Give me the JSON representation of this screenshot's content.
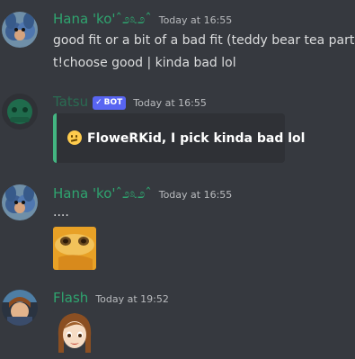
{
  "messages": [
    {
      "username": "Hana 'ko'ˆ೨೩೨ˆ",
      "timestamp": "Today at 16:55",
      "lines": [
        "good fit or a bit of a bad fit (teddy bear tea party)",
        "t!choose good | kinda bad lol"
      ]
    },
    {
      "username": "Tatsu",
      "badge": "BOT",
      "timestamp": "Today at 16:55",
      "embed_text": "FloweRKid, I pick kinda bad lol"
    },
    {
      "username": "Hana 'ko'ˆ೨೩೨ˆ",
      "timestamp": "Today at 16:55",
      "lines": [
        "...."
      ]
    },
    {
      "username": "Flash",
      "timestamp": "Today at 19:52"
    }
  ],
  "icons": {
    "embed_emoji": "thinking-face-icon",
    "badge_check": "checkmark-icon"
  },
  "colors": {
    "background": "#36393f",
    "username_green": "#2fa46f",
    "tatsu_name": "#2a6b52",
    "bot_badge": "#5865f2",
    "embed_bar": "#43b581",
    "embed_bg": "#2f3136"
  }
}
